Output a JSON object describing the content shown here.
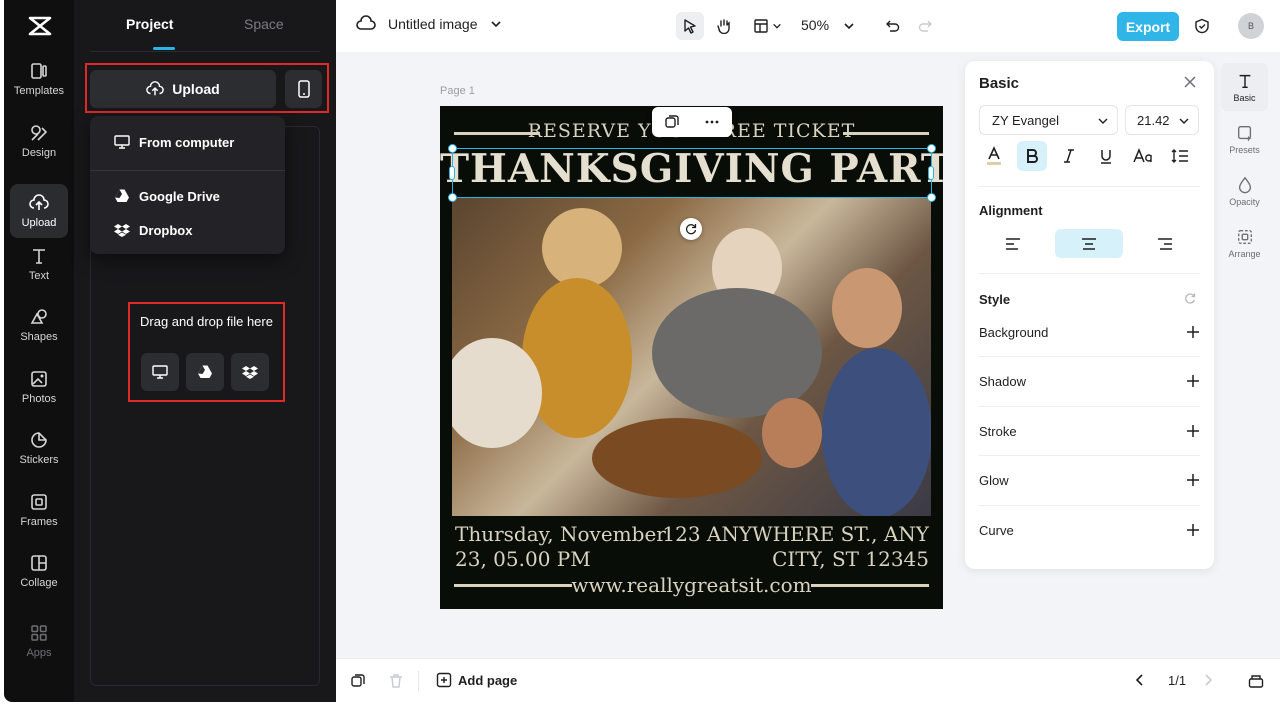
{
  "rail": {
    "items": [
      {
        "label": "Templates",
        "icon": "templates-icon"
      },
      {
        "label": "Design",
        "icon": "design-icon"
      },
      {
        "label": "Upload",
        "icon": "upload-icon"
      },
      {
        "label": "Text",
        "icon": "text-icon"
      },
      {
        "label": "Shapes",
        "icon": "shapes-icon"
      },
      {
        "label": "Photos",
        "icon": "photos-icon"
      },
      {
        "label": "Stickers",
        "icon": "stickers-icon"
      },
      {
        "label": "Frames",
        "icon": "frames-icon"
      },
      {
        "label": "Collage",
        "icon": "collage-icon"
      },
      {
        "label": "Apps",
        "icon": "apps-icon"
      }
    ],
    "active": "Upload"
  },
  "panel": {
    "tabs": [
      "Project",
      "Space"
    ],
    "upload_label": "Upload",
    "dropdown": [
      "From computer",
      "Google Drive",
      "Dropbox"
    ],
    "drop_text": "Drag and drop file here"
  },
  "topbar": {
    "title": "Untitled image",
    "zoom": "50%",
    "export_label": "Export",
    "avatar_text": "B"
  },
  "canvas": {
    "page_label": "Page 1",
    "reserve_text": "RESERVE YOUR FREE TICKET",
    "headline": "THANKSGIVING PARTY",
    "date_line1": "Thursday, November",
    "date_line2": "23, 05.00 PM",
    "address_line1": "123 ANYWHERE ST., ANY",
    "address_line2": "CITY, ST 12345",
    "website": "www.reallygreatsit.com"
  },
  "props": {
    "title": "Basic",
    "font": "ZY Evangel",
    "size": "21.42",
    "alignment_label": "Alignment",
    "style_label": "Style",
    "style_rows": [
      "Background",
      "Shadow",
      "Stroke",
      "Glow",
      "Curve"
    ]
  },
  "rrail": {
    "items": [
      "Basic",
      "Presets",
      "Opacity",
      "Arrange"
    ]
  },
  "bottombar": {
    "add_page": "Add page",
    "page_count": "1/1"
  },
  "colors": {
    "accent": "#27b4e6",
    "export": "#2fb5e8",
    "highlight_frame": "#e02a2a",
    "sidebar_bg": "#0f0f10",
    "panel_bg": "#18181b"
  }
}
